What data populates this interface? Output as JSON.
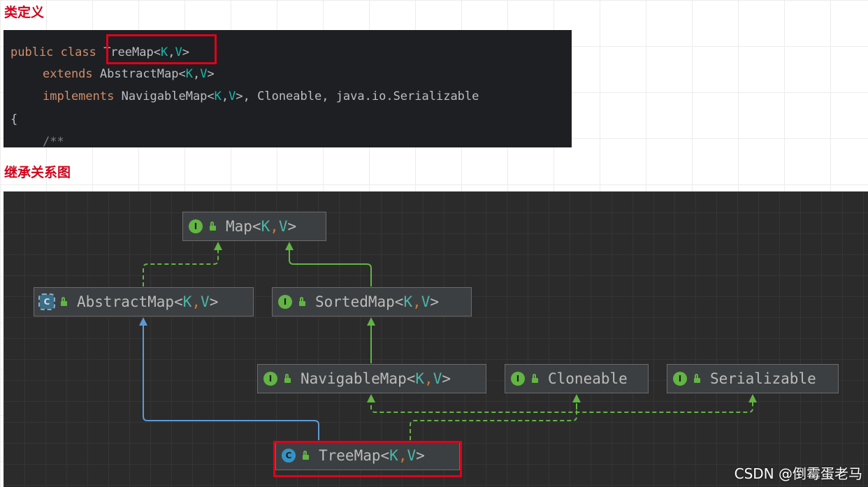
{
  "headings": {
    "class_definition": "类定义",
    "inheritance": "继承关系图"
  },
  "code": {
    "line1": {
      "kw": "public class ",
      "name": "TreeMap<",
      "k": "K",
      "sep": ",",
      "v": "V",
      "end": ">"
    },
    "line2": {
      "kw": "extends ",
      "name": "AbstractMap<",
      "k": "K",
      "sep": ",",
      "v": "V",
      "end": ">"
    },
    "line3": {
      "kw": "implements ",
      "name": "NavigableMap<",
      "k": "K",
      "sep": ",",
      "v": "V",
      "end": ">, Cloneable, java.io.Serializable"
    },
    "line4": "{",
    "line5": "/**"
  },
  "diagram": {
    "nodes": {
      "map": {
        "badge": "I",
        "name": "Map<",
        "k": "K",
        "sep": ", ",
        "v": "V",
        "end": ">"
      },
      "abstract_map": {
        "badge": "C",
        "name": "AbstractMap<",
        "k": "K",
        "sep": ", ",
        "v": "V",
        "end": ">"
      },
      "sorted_map": {
        "badge": "I",
        "name": "SortedMap<",
        "k": "K",
        "sep": ", ",
        "v": "V",
        "end": ">"
      },
      "navigable_map": {
        "badge": "I",
        "name": "NavigableMap<",
        "k": "K",
        "sep": ", ",
        "v": "V",
        "end": ">"
      },
      "cloneable": {
        "badge": "I",
        "name": "Cloneable"
      },
      "serializable": {
        "badge": "I",
        "name": "Serializable"
      },
      "tree_map": {
        "badge": "C",
        "name": "TreeMap<",
        "k": "K",
        "sep": ", ",
        "v": "V",
        "end": ">"
      }
    },
    "colors": {
      "implements_edge": "#62b543",
      "extends_edge": "#5b9bd5",
      "highlight": "#e0001b"
    }
  },
  "watermark": "CSDN @倒霉蛋老马"
}
